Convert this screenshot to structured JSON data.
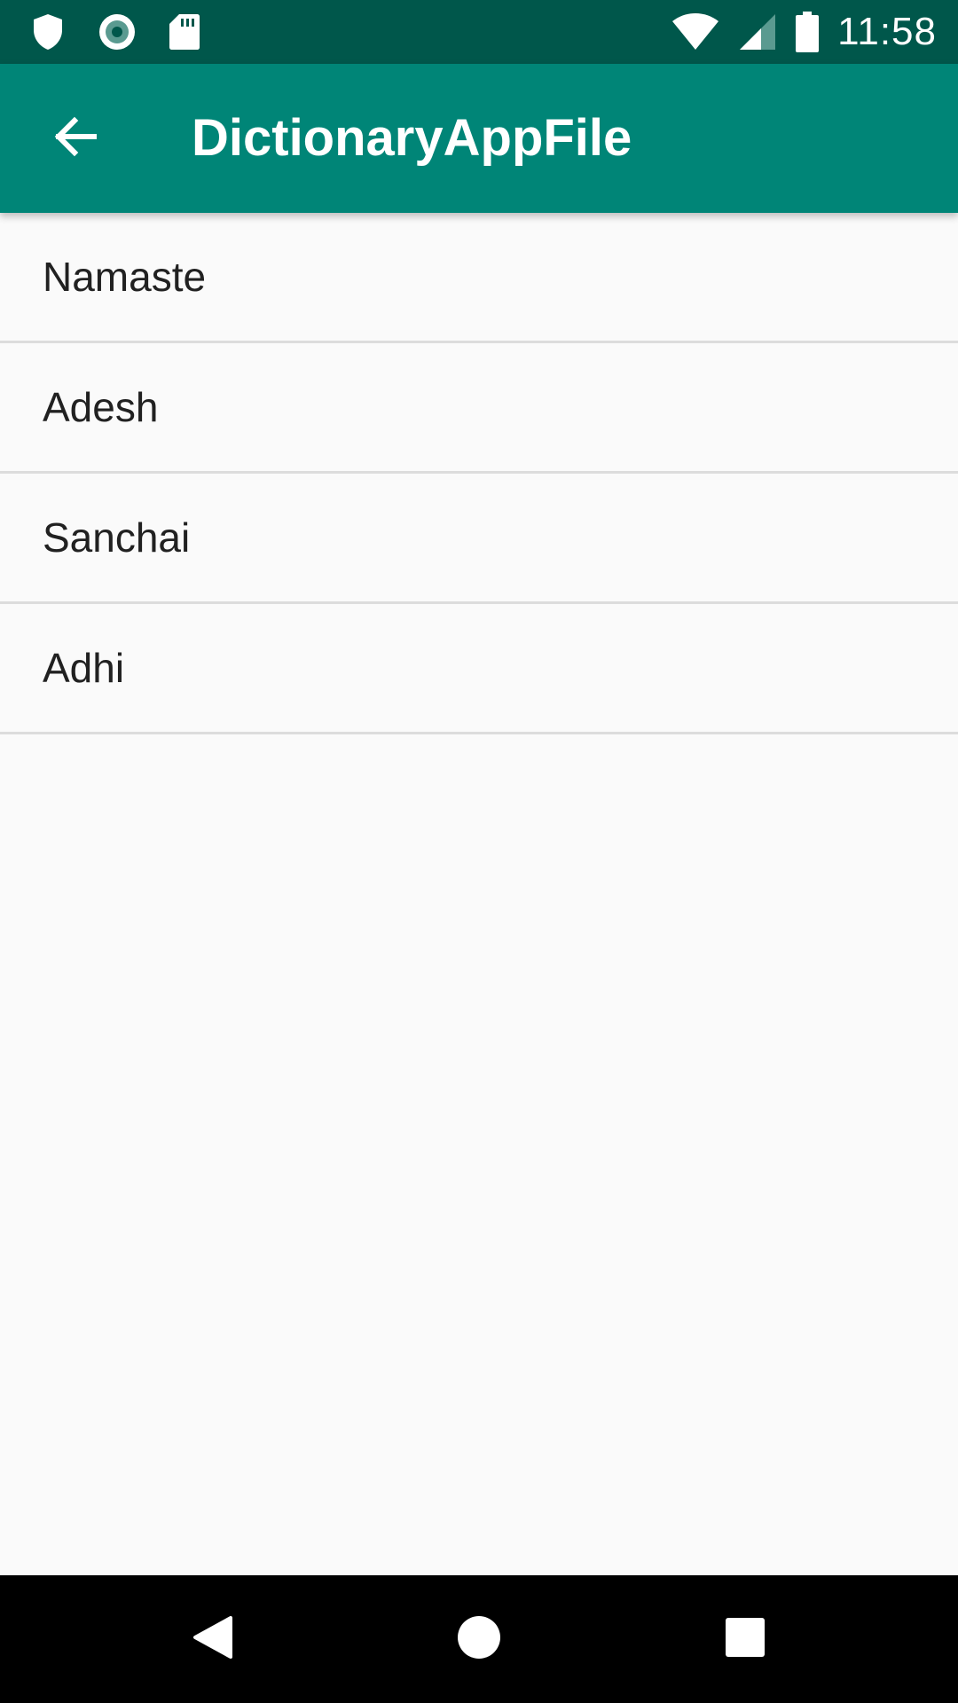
{
  "status_bar": {
    "time": "11:58",
    "left_icons": [
      "shield-icon",
      "record-icon",
      "sd-card-icon"
    ],
    "right_icons": [
      "wifi-icon",
      "cell-signal-icon",
      "battery-icon"
    ]
  },
  "app_bar": {
    "title": "DictionaryAppFile",
    "back_icon": "arrow-back-icon"
  },
  "word_list": {
    "items": [
      {
        "label": "Namaste"
      },
      {
        "label": "Adesh"
      },
      {
        "label": "Sanchai"
      },
      {
        "label": "Adhi"
      }
    ]
  },
  "nav_bar": {
    "icons": [
      "back-triangle-icon",
      "home-circle-icon",
      "recents-square-icon"
    ]
  },
  "colors": {
    "status_bar": "#00574b",
    "app_bar": "#008577",
    "background": "#fafafa",
    "divider": "#dcdcdc",
    "nav_bar": "#000000"
  }
}
